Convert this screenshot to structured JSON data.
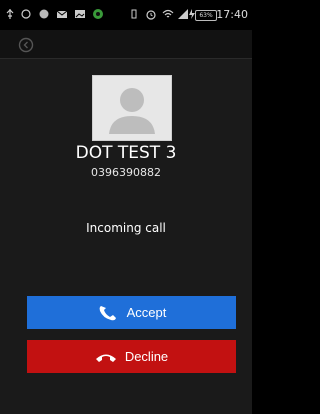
{
  "status_bar": {
    "time": "17:40",
    "battery": "63%"
  },
  "call": {
    "contact_name": "DOT TEST 3",
    "phone_number": "0396390882",
    "status_text": "Incoming call"
  },
  "buttons": {
    "accept_label": "Accept",
    "decline_label": "Decline"
  },
  "colors": {
    "accept": "#1f6fd9",
    "decline": "#c21111",
    "background": "#1a1a1a"
  },
  "icons": {
    "back": "back-arrow-icon",
    "avatar": "person-placeholder-icon",
    "accept": "phone-icon",
    "decline": "hang-up-icon"
  }
}
